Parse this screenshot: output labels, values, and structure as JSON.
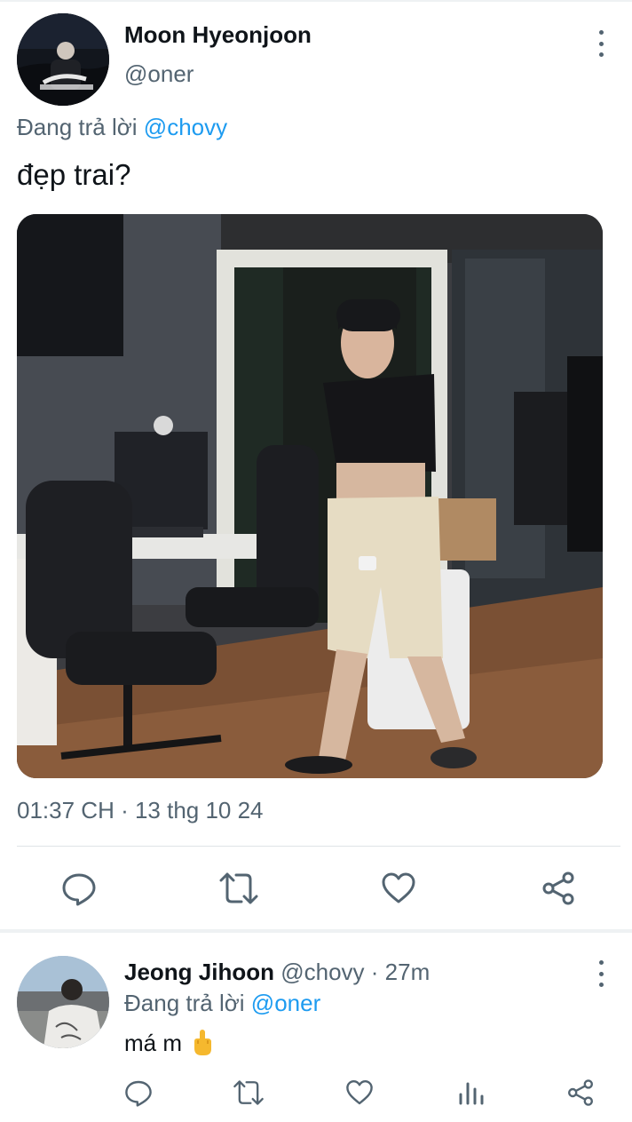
{
  "main_tweet": {
    "author_name": "Moon Hyeonjoon",
    "handle": "@oner",
    "replying_prefix": "Đang trả lời",
    "replying_to": "@chovy",
    "text": "đẹp trai?",
    "timestamp": "01:37 CH · 13 thg 10 24",
    "actions": [
      "reply-icon",
      "retweet-icon",
      "like-icon",
      "share-icon"
    ]
  },
  "reply_tweet": {
    "author_name": "Jeong Jihoon",
    "handle": "@chovy",
    "separator": " · ",
    "time_ago": "27m",
    "replying_prefix": "Đang trả lời",
    "replying_to": "@oner",
    "text": "má m",
    "emoji_icon": "middle-finger-icon",
    "actions": [
      "reply-icon",
      "retweet-icon",
      "like-icon",
      "views-icon",
      "share-icon"
    ]
  },
  "colors": {
    "text_primary": "#0f1419",
    "text_secondary": "#536471",
    "link": "#1d9bf0",
    "divider": "#dfe3e6"
  }
}
